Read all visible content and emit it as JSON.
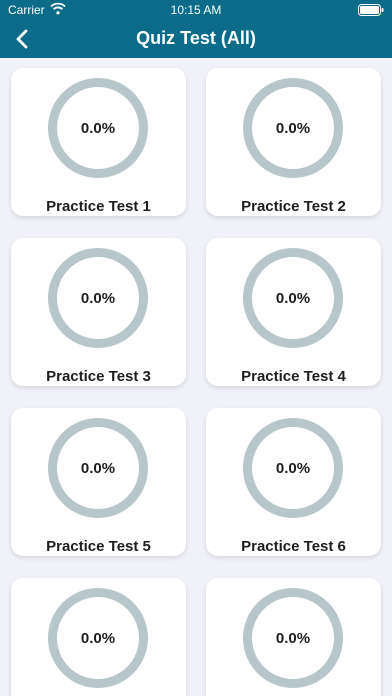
{
  "status_bar": {
    "carrier": "Carrier",
    "time": "10:15 AM",
    "wifi_icon": "wifi-icon",
    "battery_icon": "battery-icon"
  },
  "nav": {
    "title": "Quiz Test (All)",
    "back_icon": "chevron-left-icon"
  },
  "colors": {
    "nav_background": "#0b6b88",
    "page_background": "#f1f1fa",
    "ring": "#b7c6ca",
    "card": "#ffffff"
  },
  "tests": [
    {
      "label": "Practice Test 1",
      "progress": "0.0%"
    },
    {
      "label": "Practice Test 2",
      "progress": "0.0%"
    },
    {
      "label": "Practice Test 3",
      "progress": "0.0%"
    },
    {
      "label": "Practice Test 4",
      "progress": "0.0%"
    },
    {
      "label": "Practice Test 5",
      "progress": "0.0%"
    },
    {
      "label": "Practice Test 6",
      "progress": "0.0%"
    },
    {
      "label": "",
      "progress": "0.0%"
    },
    {
      "label": "",
      "progress": "0.0%"
    }
  ]
}
